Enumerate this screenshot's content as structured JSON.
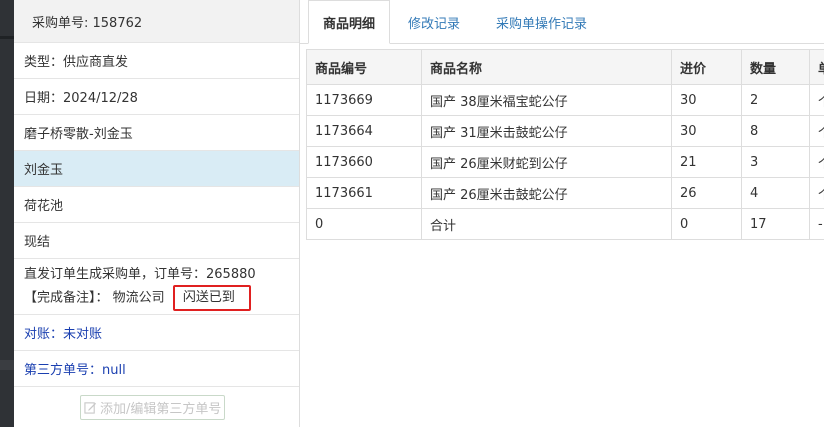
{
  "info": {
    "header": "采购单号: 158762",
    "type": "类型：供应商直发",
    "date": "日期：2024/12/28",
    "customer": "磨子桥零散-刘金玉",
    "contact": "刘金玉",
    "location": "荷花池",
    "settlement": "现结",
    "note_line1": "直发订单生成采购单，订单号：265880",
    "note_label": "【完成备注】：",
    "note_company": "物流公司",
    "note_flash": "闪送已到",
    "reconcile": "对账：未对账",
    "third_party": "第三方单号：null",
    "add_button": "添加/编辑第三方单号"
  },
  "tabs": [
    "商品明细",
    "修改记录",
    "采购单操作记录"
  ],
  "table": {
    "headers": [
      "商品编号",
      "商品名称",
      "进价",
      "数量",
      "单"
    ],
    "rows": [
      [
        "1173669",
        "国产 38厘米福宝蛇公仔",
        "30",
        "2",
        "个"
      ],
      [
        "1173664",
        "国产 31厘米击鼓蛇公仔",
        "30",
        "8",
        "个"
      ],
      [
        "1173660",
        "国产 26厘米财蛇到公仔",
        "21",
        "3",
        "个"
      ],
      [
        "1173661",
        "国产 26厘米击鼓蛇公仔",
        "26",
        "4",
        "个"
      ],
      [
        "0",
        "合计",
        "0",
        "17",
        "-"
      ]
    ]
  },
  "colors": {
    "accent": "#337ab7",
    "active_row": "#d9ecf5",
    "highlight_box": "#e02020",
    "link_blue": "#1a3fb0"
  },
  "icons": [
    "edit-icon"
  ]
}
